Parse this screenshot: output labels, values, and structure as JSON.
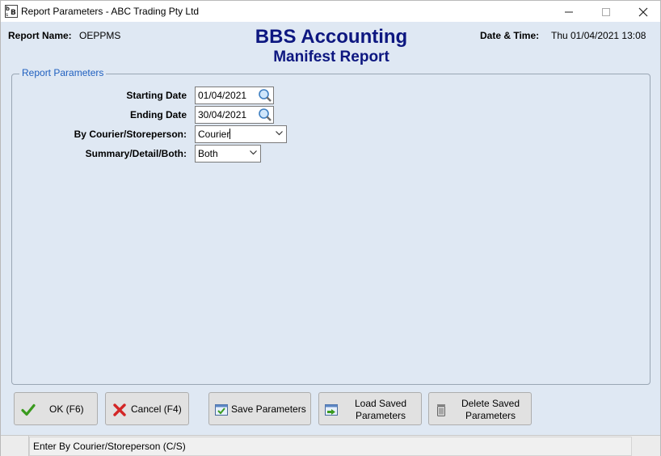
{
  "window": {
    "title": "Report Parameters - ABC Trading Pty Ltd",
    "icon": "bbs-app-icon"
  },
  "header": {
    "report_name_label": "Report Name:",
    "report_name": "OEPPMS",
    "title": "BBS Accounting",
    "subtitle": "Manifest Report",
    "datetime_label": "Date & Time:",
    "datetime": "Thu 01/04/2021 13:08",
    "title_color": "#0d1780"
  },
  "params": {
    "group_label": "Report Parameters",
    "starting_date_label": "Starting Date",
    "starting_date": "01/04/2021",
    "ending_date_label": "Ending Date",
    "ending_date": "30/04/2021",
    "courier_label": "By Courier/Storeperson:",
    "courier_value": "Courier",
    "summary_label": "Summary/Detail/Both:",
    "summary_value": "Both"
  },
  "buttons": {
    "ok": "OK (F6)",
    "cancel": "Cancel (F4)",
    "save": "Save Parameters",
    "load_line1": "Load Saved",
    "load_line2": "Parameters",
    "delete_line1": "Delete Saved",
    "delete_line2": "Parameters"
  },
  "status": {
    "text": "Enter By Courier/Storeperson (C/S)"
  },
  "colors": {
    "background": "#dfe8f3",
    "legend": "#1f5fbf"
  }
}
